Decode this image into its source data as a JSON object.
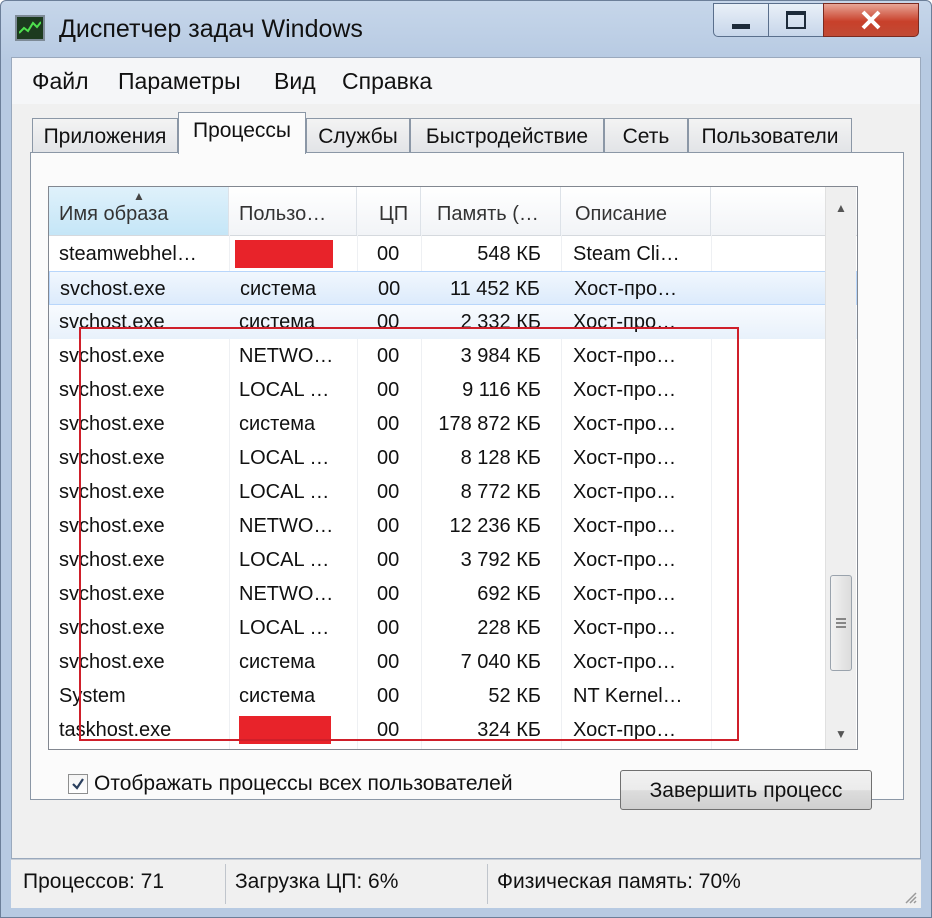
{
  "window": {
    "title": "Диспетчер задач Windows"
  },
  "menu": [
    "Файл",
    "Параметры",
    "Вид",
    "Справка"
  ],
  "tabs": [
    "Приложения",
    "Процессы",
    "Службы",
    "Быстродействие",
    "Сеть",
    "Пользователи"
  ],
  "active_tab": "Процессы",
  "columns": [
    "Имя образа",
    "Пользо…",
    "ЦП",
    "Память (…",
    "Описание"
  ],
  "rows": [
    {
      "name": "steamwebhel…",
      "user": "",
      "cpu": "00",
      "mem": "548 КБ",
      "desc": "Steam Cli…"
    },
    {
      "name": "svchost.exe",
      "user": "система",
      "cpu": "00",
      "mem": "11 452 КБ",
      "desc": "Хост-про…"
    },
    {
      "name": "svchost.exe",
      "user": "система",
      "cpu": "00",
      "mem": "2 332 КБ",
      "desc": "Хост-про…"
    },
    {
      "name": "svchost.exe",
      "user": "NETWO…",
      "cpu": "00",
      "mem": "3 984 КБ",
      "desc": "Хост-про…"
    },
    {
      "name": "svchost.exe",
      "user": "LOCAL …",
      "cpu": "00",
      "mem": "9 116 КБ",
      "desc": "Хост-про…"
    },
    {
      "name": "svchost.exe",
      "user": "система",
      "cpu": "00",
      "mem": "178 872 КБ",
      "desc": "Хост-про…"
    },
    {
      "name": "svchost.exe",
      "user": "LOCAL …",
      "cpu": "00",
      "mem": "8 128 КБ",
      "desc": "Хост-про…"
    },
    {
      "name": "svchost.exe",
      "user": "LOCAL …",
      "cpu": "00",
      "mem": "8 772 КБ",
      "desc": "Хост-про…"
    },
    {
      "name": "svchost.exe",
      "user": "NETWO…",
      "cpu": "00",
      "mem": "12 236 КБ",
      "desc": "Хост-про…"
    },
    {
      "name": "svchost.exe",
      "user": "LOCAL …",
      "cpu": "00",
      "mem": "3 792 КБ",
      "desc": "Хост-про…"
    },
    {
      "name": "svchost.exe",
      "user": "NETWO…",
      "cpu": "00",
      "mem": "692 КБ",
      "desc": "Хост-про…"
    },
    {
      "name": "svchost.exe",
      "user": "LOCAL …",
      "cpu": "00",
      "mem": "228 КБ",
      "desc": "Хост-про…"
    },
    {
      "name": "svchost.exe",
      "user": "система",
      "cpu": "00",
      "mem": "7 040 КБ",
      "desc": "Хост-про…"
    },
    {
      "name": "System",
      "user": "система",
      "cpu": "00",
      "mem": "52 КБ",
      "desc": "NT Kernel…"
    },
    {
      "name": "taskhost.exe",
      "user": "",
      "cpu": "00",
      "mem": "324 КБ",
      "desc": "Хост-про…"
    }
  ],
  "redacted_color": "#e8232a",
  "highlight_box_color": "#cf1f2a",
  "show_all_processes": {
    "label": "Отображать процессы всех пользователей",
    "checked": true
  },
  "end_process_button": "Завершить процесс",
  "status": {
    "processes": "Процессов: 71",
    "cpu": "Загрузка ЦП: 6%",
    "memory": "Физическая память: 70%"
  }
}
